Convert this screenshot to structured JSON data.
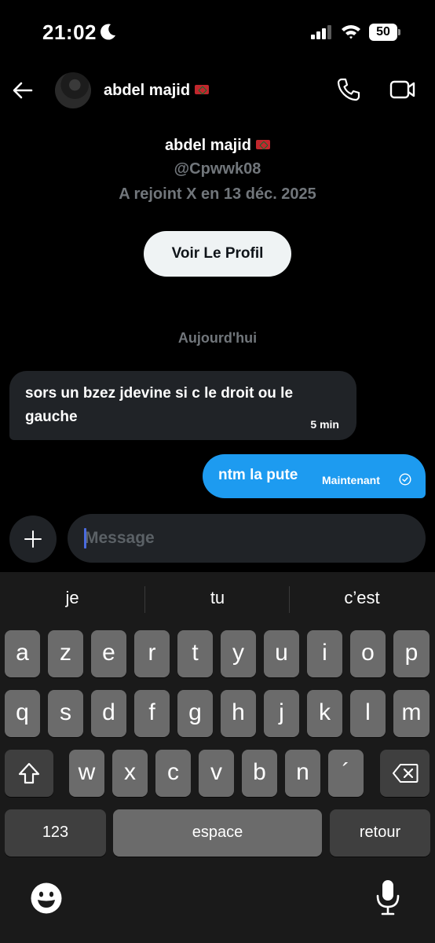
{
  "status_bar": {
    "time": "21:02",
    "battery": "50"
  },
  "header": {
    "name": "abdel majid"
  },
  "profile": {
    "name": "abdel majid",
    "handle": "@Cpwwk08",
    "joined": "A rejoint X en 13 déc. 2025",
    "view_button": "Voir Le Profil"
  },
  "date_separator": "Aujourd'hui",
  "messages": [
    {
      "direction": "in",
      "text": "sors un bzez jdevine si c le droit ou le gauche",
      "time": "5 min"
    },
    {
      "direction": "out",
      "text": "ntm la pute",
      "time": "Maintenant"
    }
  ],
  "composer": {
    "placeholder": "Message"
  },
  "keyboard": {
    "suggestions": [
      "je",
      "tu",
      "c’est"
    ],
    "row1": [
      "a",
      "z",
      "e",
      "r",
      "t",
      "y",
      "u",
      "i",
      "o",
      "p"
    ],
    "row2": [
      "q",
      "s",
      "d",
      "f",
      "g",
      "h",
      "j",
      "k",
      "l",
      "m"
    ],
    "row3": [
      "w",
      "x",
      "c",
      "v",
      "b",
      "n",
      "´"
    ],
    "numbers_key": "123",
    "space_key": "espace",
    "return_key": "retour"
  },
  "colors": {
    "accent": "#1d9bf0",
    "bubble_in": "#202327",
    "muted_text": "#71767b",
    "flag": "#c1272d"
  },
  "icons": [
    "moon-icon",
    "signal-icon",
    "wifi-icon",
    "back-arrow-icon",
    "phone-icon",
    "video-icon",
    "check-circle-icon",
    "plus-icon",
    "shift-icon",
    "backspace-icon",
    "emoji-icon",
    "microphone-icon"
  ]
}
